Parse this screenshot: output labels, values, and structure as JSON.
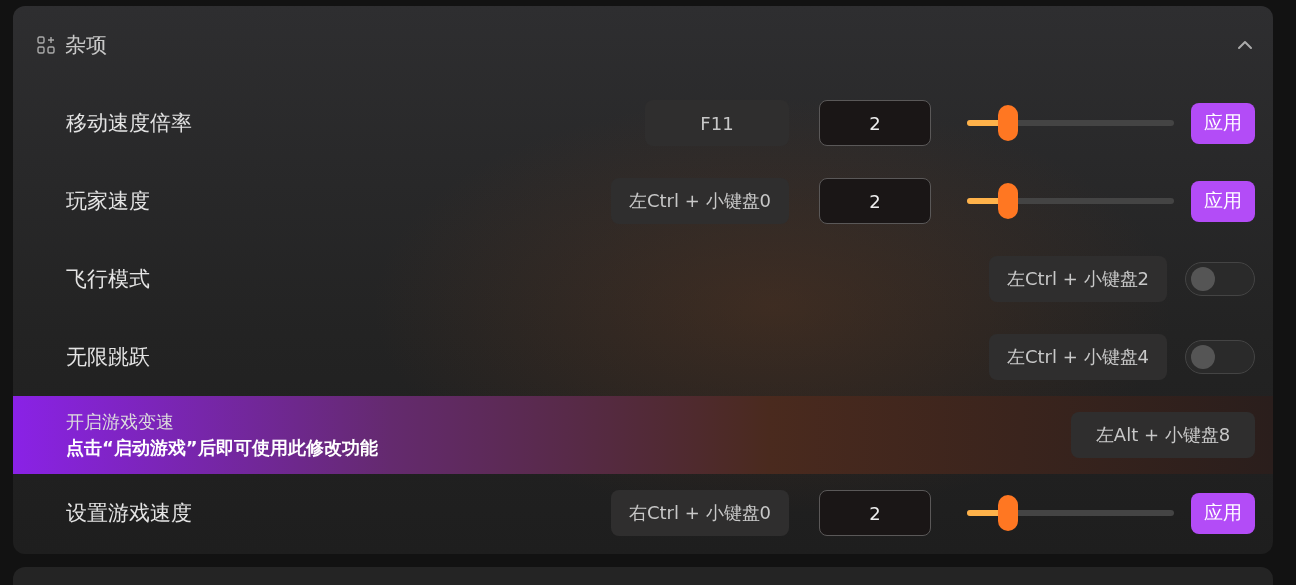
{
  "section": {
    "title": "杂项",
    "expanded": true
  },
  "rows": [
    {
      "kind": "slider",
      "label": "移动速度倍率",
      "hotkey": "F11",
      "value": "2",
      "level": 0.2,
      "button": "应用"
    },
    {
      "kind": "slider",
      "label": "玩家速度",
      "hotkey": "左Ctrl + 小键盘0",
      "value": "2",
      "level": 0.2,
      "button": "应用"
    },
    {
      "kind": "toggle",
      "label": "飞行模式",
      "hotkey": "左Ctrl + 小键盘2",
      "on": false
    },
    {
      "kind": "toggle",
      "label": "无限跳跃",
      "hotkey": "左Ctrl + 小键盘4",
      "on": false
    },
    {
      "kind": "notice",
      "title": "开启游戏变速",
      "message": "点击“启动游戏”后即可使用此修改功能",
      "hotkey": "左Alt + 小键盘8"
    },
    {
      "kind": "slider",
      "label": "设置游戏速度",
      "hotkey": "右Ctrl + 小键盘0",
      "value": "2",
      "level": 0.2,
      "button": "应用"
    }
  ]
}
